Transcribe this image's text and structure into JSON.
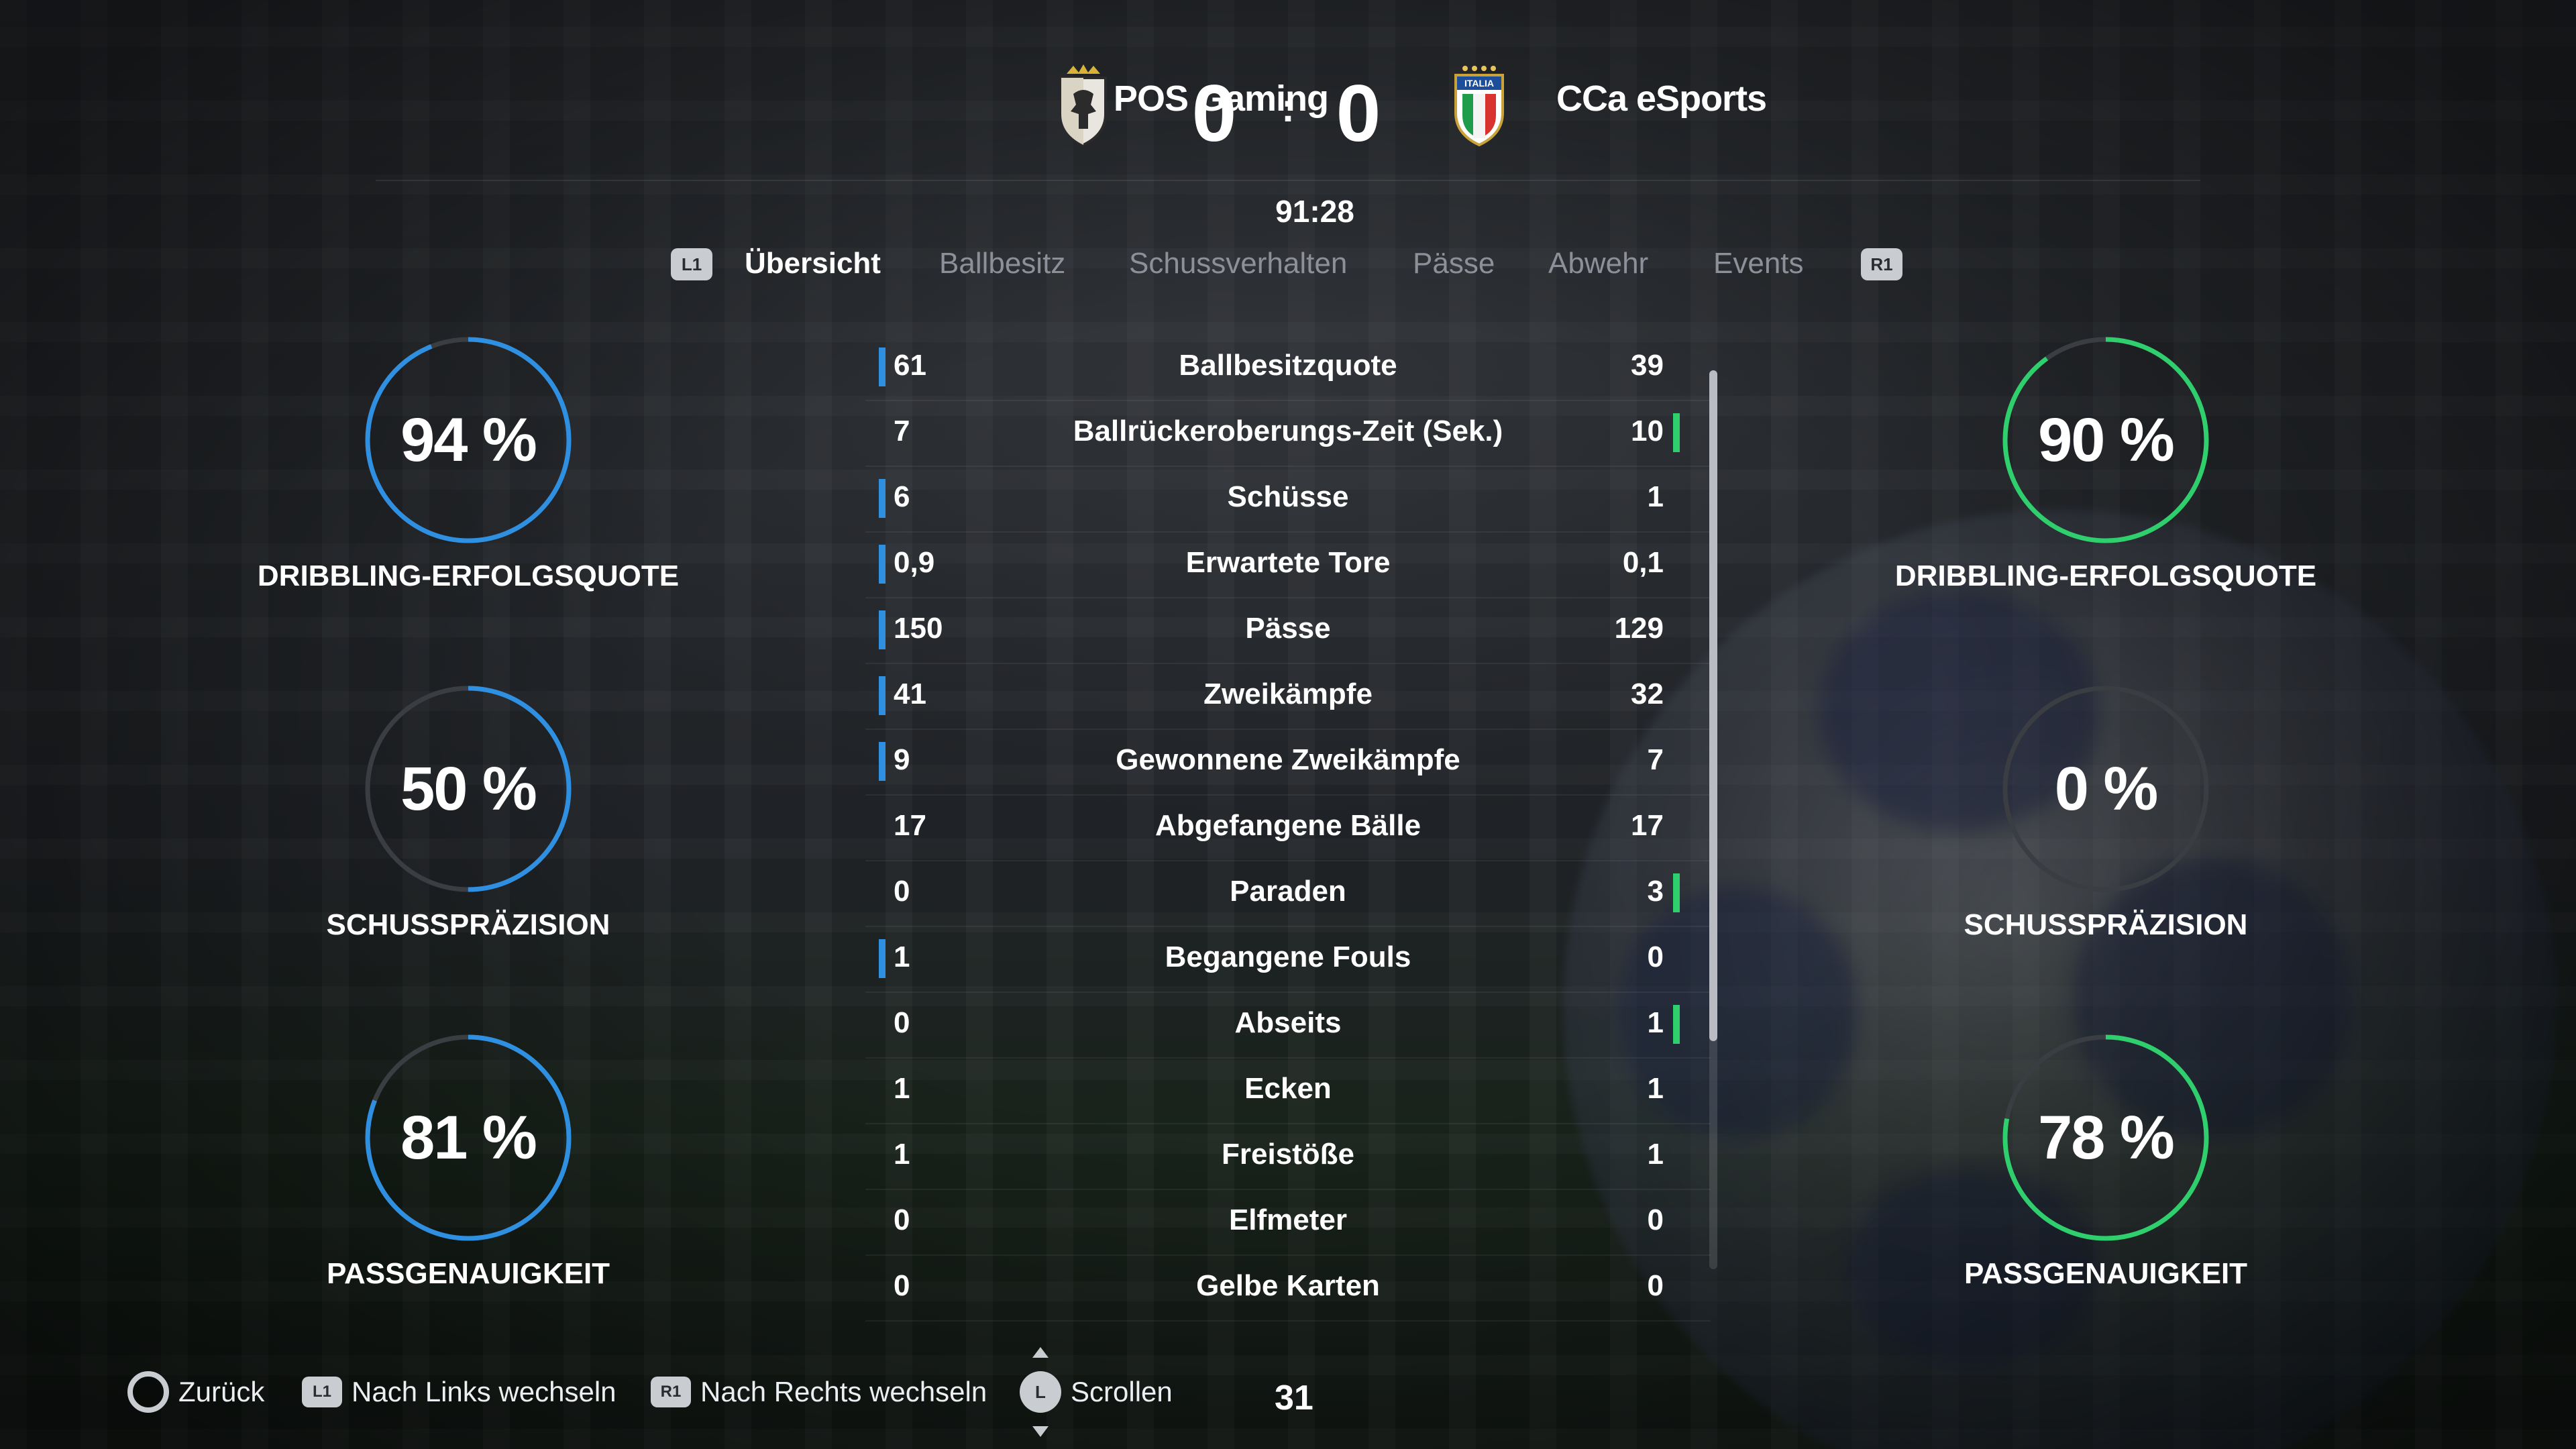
{
  "header": {
    "home_team": "POS Gaming",
    "away_team": "CCa eSports",
    "home_score": "0",
    "away_score": "0",
    "separator": ":",
    "match_time": "91:28",
    "away_crest_text": "ITALIA"
  },
  "tabs": {
    "left_button": "L1",
    "right_button": "R1",
    "items": [
      {
        "label": "Übersicht",
        "active": true
      },
      {
        "label": "Ballbesitz",
        "active": false
      },
      {
        "label": "Schussverhalten",
        "active": false
      },
      {
        "label": "Pässe",
        "active": false
      },
      {
        "label": "Abwehr",
        "active": false
      },
      {
        "label": "Events",
        "active": false
      }
    ]
  },
  "rings": {
    "home": [
      {
        "value": "94 %",
        "percent": 94,
        "label": "DRIBBLING-ERFOLGSQUOTE"
      },
      {
        "value": "50 %",
        "percent": 50,
        "label": "SCHUSSPRÄZISION"
      },
      {
        "value": "81 %",
        "percent": 81,
        "label": "PASSGENAUIGKEIT"
      }
    ],
    "away": [
      {
        "value": "90 %",
        "percent": 90,
        "label": "DRIBBLING-ERFOLGSQUOTE"
      },
      {
        "value": "0 %",
        "percent": 0,
        "label": "SCHUSSPRÄZISION"
      },
      {
        "value": "78 %",
        "percent": 78,
        "label": "PASSGENAUIGKEIT"
      }
    ],
    "home_color": "#2f8fe0",
    "away_color": "#2fcf6e",
    "track_color": "#3a3d42"
  },
  "stats": [
    {
      "label": "Ballbesitzquote",
      "home": "61",
      "away": "39",
      "leader": "home"
    },
    {
      "label": "Ballrückeroberungs-Zeit (Sek.)",
      "home": "7",
      "away": "10",
      "leader": "away"
    },
    {
      "label": "Schüsse",
      "home": "6",
      "away": "1",
      "leader": "home"
    },
    {
      "label": "Erwartete Tore",
      "home": "0,9",
      "away": "0,1",
      "leader": "home"
    },
    {
      "label": "Pässe",
      "home": "150",
      "away": "129",
      "leader": "home"
    },
    {
      "label": "Zweikämpfe",
      "home": "41",
      "away": "32",
      "leader": "home"
    },
    {
      "label": "Gewonnene Zweikämpfe",
      "home": "9",
      "away": "7",
      "leader": "home"
    },
    {
      "label": "Abgefangene Bälle",
      "home": "17",
      "away": "17",
      "leader": "none"
    },
    {
      "label": "Paraden",
      "home": "0",
      "away": "3",
      "leader": "away"
    },
    {
      "label": "Begangene Fouls",
      "home": "1",
      "away": "0",
      "leader": "home"
    },
    {
      "label": "Abseits",
      "home": "0",
      "away": "1",
      "leader": "away"
    },
    {
      "label": "Ecken",
      "home": "1",
      "away": "1",
      "leader": "none"
    },
    {
      "label": "Freistöße",
      "home": "1",
      "away": "1",
      "leader": "none"
    },
    {
      "label": "Elfmeter",
      "home": "0",
      "away": "0",
      "leader": "none"
    },
    {
      "label": "Gelbe Karten",
      "home": "0",
      "away": "0",
      "leader": "none"
    }
  ],
  "footer": {
    "back_label": "Zurück",
    "left_button": "L1",
    "left_label": "Nach Links wechseln",
    "right_button": "R1",
    "right_label": "Nach Rechts wechseln",
    "scroll_button": "L",
    "scroll_label": "Scrollen",
    "page_counter": "31"
  },
  "icons": {
    "back": "circle-button-icon",
    "scroll": "left-stick-icon",
    "home_crest": "pos-gaming-crest-icon",
    "away_crest": "italia-crest-icon"
  }
}
